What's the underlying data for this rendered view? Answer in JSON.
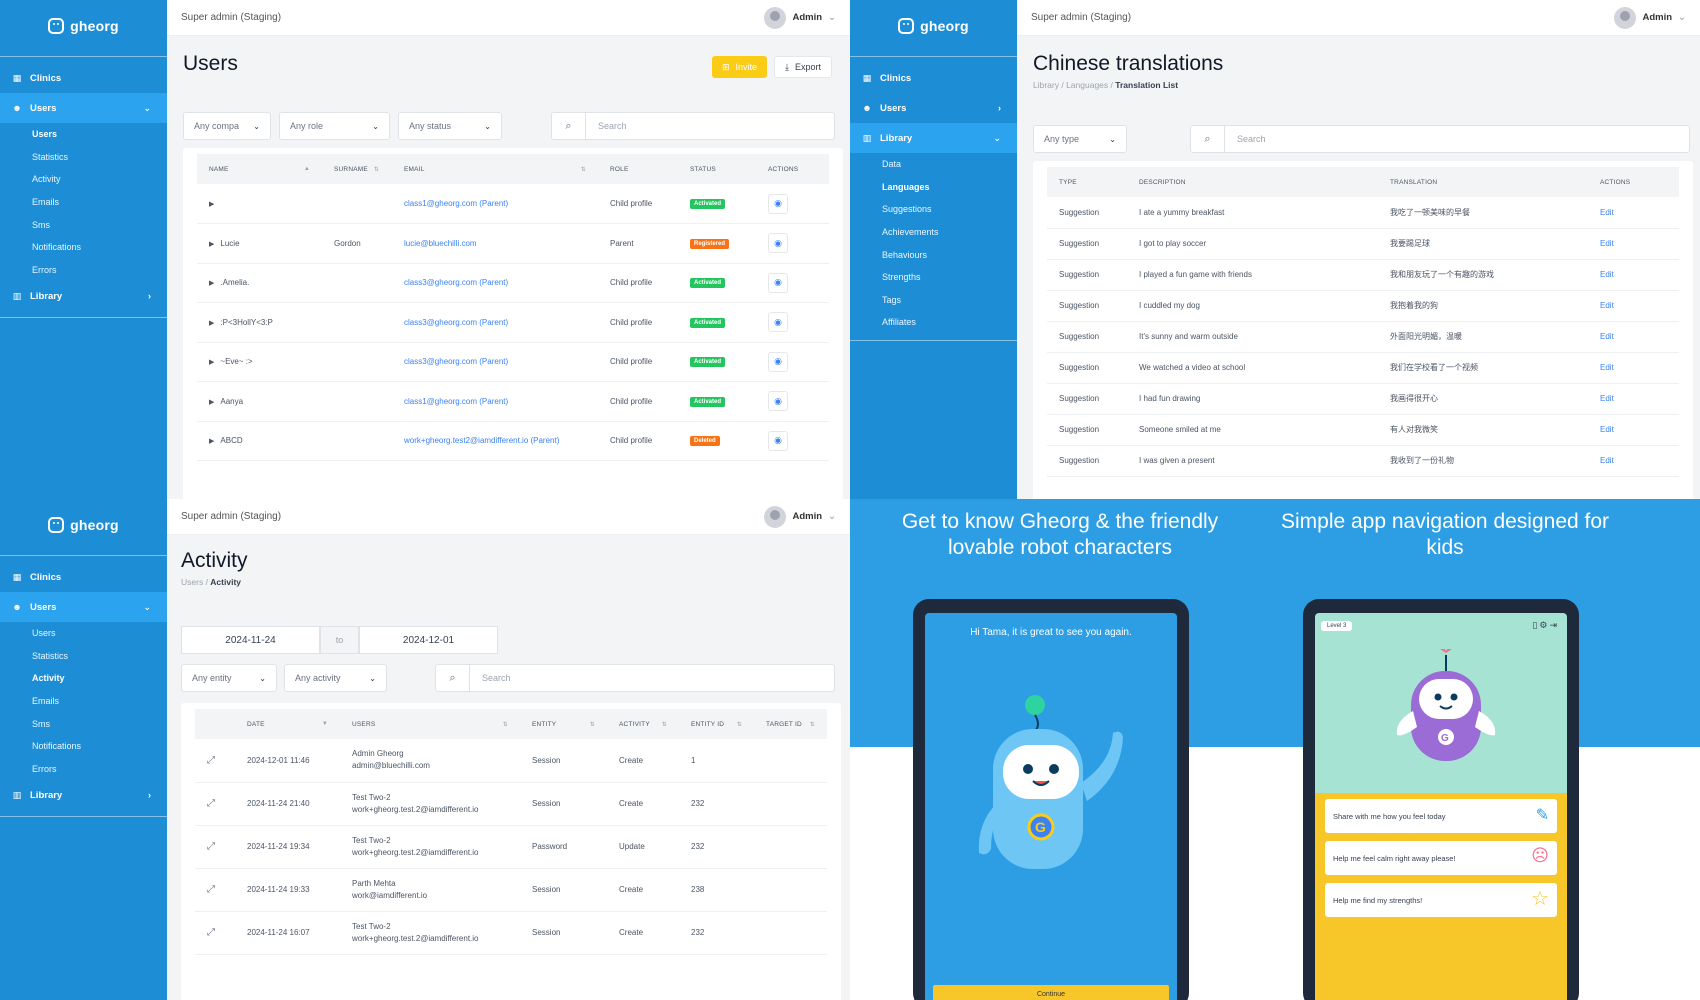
{
  "brand": {
    "logo_text": "gheorg"
  },
  "topbar": {
    "env": "Super admin (Staging)",
    "user": "Admin"
  },
  "users_screen": {
    "sidebar": {
      "clinics": "Clinics",
      "users": "Users",
      "sub": [
        "Users",
        "Statistics",
        "Activity",
        "Emails",
        "Sms",
        "Notifications",
        "Errors"
      ],
      "library": "Library"
    },
    "title": "Users",
    "invite": "Invite",
    "export": "Export",
    "filters": {
      "company": "Any compa",
      "role": "Any role",
      "status": "Any status",
      "search": "Search"
    },
    "columns": [
      "NAME",
      "SURNAME",
      "EMAIL",
      "ROLE",
      "STATUS",
      "ACTIONS"
    ],
    "rows": [
      {
        "name": "",
        "surname": "",
        "email": "class1@gheorg.com (Parent)",
        "role": "Child profile",
        "status": "Activated"
      },
      {
        "name": "Lucie",
        "surname": "Gordon",
        "email": "lucie@bluechilli.com",
        "role": "Parent",
        "status": "Registered"
      },
      {
        "name": ".Amelia.",
        "surname": "",
        "email": "class3@gheorg.com (Parent)",
        "role": "Child profile",
        "status": "Activated"
      },
      {
        "name": ":P<3HollY<3:P",
        "surname": "",
        "email": "class3@gheorg.com (Parent)",
        "role": "Child profile",
        "status": "Activated"
      },
      {
        "name": "~Eve~ :>",
        "surname": "",
        "email": "class3@gheorg.com (Parent)",
        "role": "Child profile",
        "status": "Activated"
      },
      {
        "name": "Aanya",
        "surname": "",
        "email": "class1@gheorg.com (Parent)",
        "role": "Child profile",
        "status": "Activated"
      },
      {
        "name": "ABCD",
        "surname": "",
        "email": "work+gheorg.test2@iamdifferent.io (Parent)",
        "role": "Child profile",
        "status": "Deleted"
      }
    ]
  },
  "translations_screen": {
    "sidebar": {
      "clinics": "Clinics",
      "users": "Users",
      "library": "Library",
      "sub": [
        "Data",
        "Languages",
        "Suggestions",
        "Achievements",
        "Behaviours",
        "Strengths",
        "Tags",
        "Affiliates"
      ]
    },
    "title": "Chinese translations",
    "breadcrumb": [
      "Library",
      "Languages",
      "Translation List"
    ],
    "filters": {
      "type": "Any type",
      "search": "Search"
    },
    "columns": [
      "TYPE",
      "DESCRIPTION",
      "TRANSLATION",
      "ACTIONS"
    ],
    "rows": [
      {
        "type": "Suggestion",
        "description": "I ate a yummy breakfast",
        "translation": "我吃了一顿美味的早餐",
        "action": "Edit"
      },
      {
        "type": "Suggestion",
        "description": "I got to play soccer",
        "translation": "我要踢足球",
        "action": "Edit"
      },
      {
        "type": "Suggestion",
        "description": "I played a fun game with friends",
        "translation": "我和朋友玩了一个有趣的游戏",
        "action": "Edit"
      },
      {
        "type": "Suggestion",
        "description": "I cuddled my dog",
        "translation": "我抱着我的狗",
        "action": "Edit"
      },
      {
        "type": "Suggestion",
        "description": "It's sunny and warm outside",
        "translation": "外面阳光明媚，温暖",
        "action": "Edit"
      },
      {
        "type": "Suggestion",
        "description": "We watched a video at school",
        "translation": "我们在学校看了一个视频",
        "action": "Edit"
      },
      {
        "type": "Suggestion",
        "description": "I had fun drawing",
        "translation": "我画得很开心",
        "action": "Edit"
      },
      {
        "type": "Suggestion",
        "description": "Someone smiled at me",
        "translation": "有人对我微笑",
        "action": "Edit"
      },
      {
        "type": "Suggestion",
        "description": "I was given a present",
        "translation": "我收到了一份礼物",
        "action": "Edit"
      }
    ]
  },
  "activity_screen": {
    "sidebar": {
      "clinics": "Clinics",
      "users": "Users",
      "sub": [
        "Users",
        "Statistics",
        "Activity",
        "Emails",
        "Sms",
        "Notifications",
        "Errors"
      ],
      "library": "Library"
    },
    "title": "Activity",
    "breadcrumb": [
      "Users",
      "Activity"
    ],
    "date_from": "2024-11-24",
    "date_to_label": "to",
    "date_to": "2024-12-01",
    "filters": {
      "entity": "Any entity",
      "activity": "Any activity",
      "search": "Search"
    },
    "columns": [
      "DATE",
      "USERS",
      "ENTITY",
      "ACTIVITY",
      "ENTITY ID",
      "TARGET ID"
    ],
    "rows": [
      {
        "date": "2024-12-01 11:46",
        "user": "Admin Gheorg",
        "email": "admin@bluechilli.com",
        "entity": "Session",
        "activity": "Create",
        "entity_id": "1",
        "target_id": ""
      },
      {
        "date": "2024-11-24 21:40",
        "user": "Test Two-2",
        "email": "work+gheorg.test.2@iamdifferent.io",
        "entity": "Session",
        "activity": "Create",
        "entity_id": "232",
        "target_id": ""
      },
      {
        "date": "2024-11-24 19:34",
        "user": "Test Two-2",
        "email": "work+gheorg.test.2@iamdifferent.io",
        "entity": "Password",
        "activity": "Update",
        "entity_id": "232",
        "target_id": ""
      },
      {
        "date": "2024-11-24 19:33",
        "user": "Parth Mehta",
        "email": "work@iamdifferent.io",
        "entity": "Session",
        "activity": "Create",
        "entity_id": "238",
        "target_id": ""
      },
      {
        "date": "2024-11-24 16:07",
        "user": "Test Two-2",
        "email": "work+gheorg.test.2@iamdifferent.io",
        "entity": "Session",
        "activity": "Create",
        "entity_id": "232",
        "target_id": ""
      }
    ]
  },
  "promo": {
    "left_title": "Get to know Gheorg & the friendly lovable robot characters",
    "right_title": "Simple app navigation designed for kids",
    "greeting": "Hi Tama, it is great to see you again.",
    "continue": "Continue",
    "level": "Level 3",
    "cards": [
      "Share with me how you feel today",
      "Help me feel calm right away please!",
      "Help me find my strengths!"
    ],
    "colors": {
      "bg": "#2e9ee4",
      "button": "#f7c629",
      "purple": "#9b6bd6"
    }
  },
  "colors": {
    "sidebar": "#1d8ed6",
    "sidebar_active": "#2ba3ef",
    "activated": "#22c55e",
    "registered": "#f97316",
    "deleted": "#f97316",
    "invite": "#facc15"
  }
}
